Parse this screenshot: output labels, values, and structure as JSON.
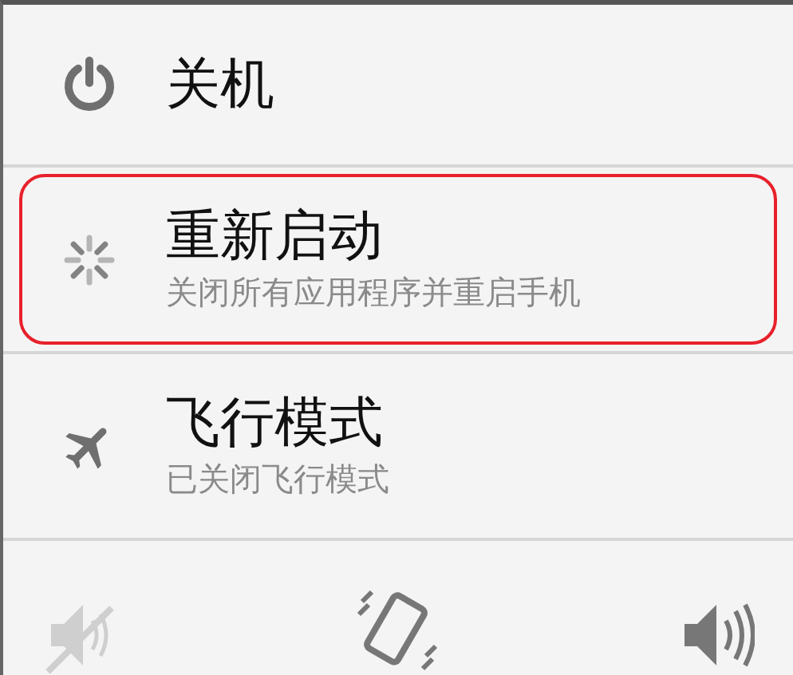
{
  "menu_items": [
    {
      "kind": "power",
      "title": "关机",
      "highlighted": false
    },
    {
      "kind": "restart",
      "title": "重新启动",
      "subtitle": "关闭所有应用程序并重启手机",
      "highlighted": true
    },
    {
      "kind": "airplane",
      "title": "飞行模式",
      "subtitle": "已关闭飞行模式",
      "highlighted": false
    }
  ],
  "sound_modes": [
    {
      "kind": "mute",
      "disabled": true
    },
    {
      "kind": "vibrate",
      "disabled": false
    },
    {
      "kind": "ring",
      "disabled": false
    }
  ]
}
